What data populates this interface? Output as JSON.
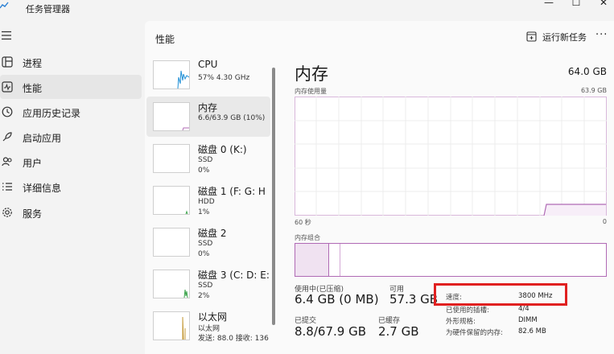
{
  "app": {
    "title": "任务管理器"
  },
  "window": {
    "minimize": "—",
    "maximize": "☐",
    "close": "✕"
  },
  "sidebar": {
    "items": [
      {
        "label": "进程",
        "icon": "grid-icon"
      },
      {
        "label": "性能",
        "icon": "performance-icon"
      },
      {
        "label": "应用历史记录",
        "icon": "history-icon"
      },
      {
        "label": "启动应用",
        "icon": "startup-icon"
      },
      {
        "label": "用户",
        "icon": "users-icon"
      },
      {
        "label": "详细信息",
        "icon": "list-icon"
      },
      {
        "label": "服务",
        "icon": "gear-icon"
      }
    ],
    "active_index": 1
  },
  "header": {
    "title": "性能",
    "run_task": "运行新任务",
    "more": "···"
  },
  "devices": [
    {
      "name": "CPU",
      "sub1": "57% 4.30 GHz",
      "sub2": ""
    },
    {
      "name": "内存",
      "sub1": "6.6/63.9 GB (10%)",
      "sub2": ""
    },
    {
      "name": "磁盘 0 (K:)",
      "sub1": "SSD",
      "sub2": "0%"
    },
    {
      "name": "磁盘 1 (F: G: H",
      "sub1": "HDD",
      "sub2": "1%"
    },
    {
      "name": "磁盘 2",
      "sub1": "SSD",
      "sub2": "0%"
    },
    {
      "name": "磁盘 3 (C: D: E:",
      "sub1": "SSD",
      "sub2": "2%"
    },
    {
      "name": "以太网",
      "sub1": "以太网",
      "sub2": "发送: 88.0 接收: 136"
    }
  ],
  "detail": {
    "title": "内存",
    "total": "64.0 GB",
    "usage_label": "内存使用量",
    "usage_max": "63.9 GB",
    "axis_left": "60 秒",
    "axis_right": "0",
    "composition_label": "内存组合",
    "stats": {
      "in_use_label": "使用中(已压缩)",
      "in_use_value": "6.4 GB (0 MB)",
      "available_label": "可用",
      "available_value": "57.3 GB",
      "committed_label": "已提交",
      "committed_value": "8.8/67.9 GB",
      "cached_label": "已缓存",
      "cached_value": "2.7 GB"
    },
    "specs": [
      {
        "k": "速度:",
        "v": "3800 MHz"
      },
      {
        "k": "已使用的插槽:",
        "v": "4/4"
      },
      {
        "k": "外形规格:",
        "v": "DIMM"
      },
      {
        "k": "为硬件保留的内存:",
        "v": "82.6 MB"
      }
    ]
  },
  "colors": {
    "accent": "#b06ab5",
    "highlight": "#e02020",
    "cpu_line": "#1f8fd6",
    "disk_line": "#3aa34a",
    "eth_line": "#c49a3a"
  }
}
